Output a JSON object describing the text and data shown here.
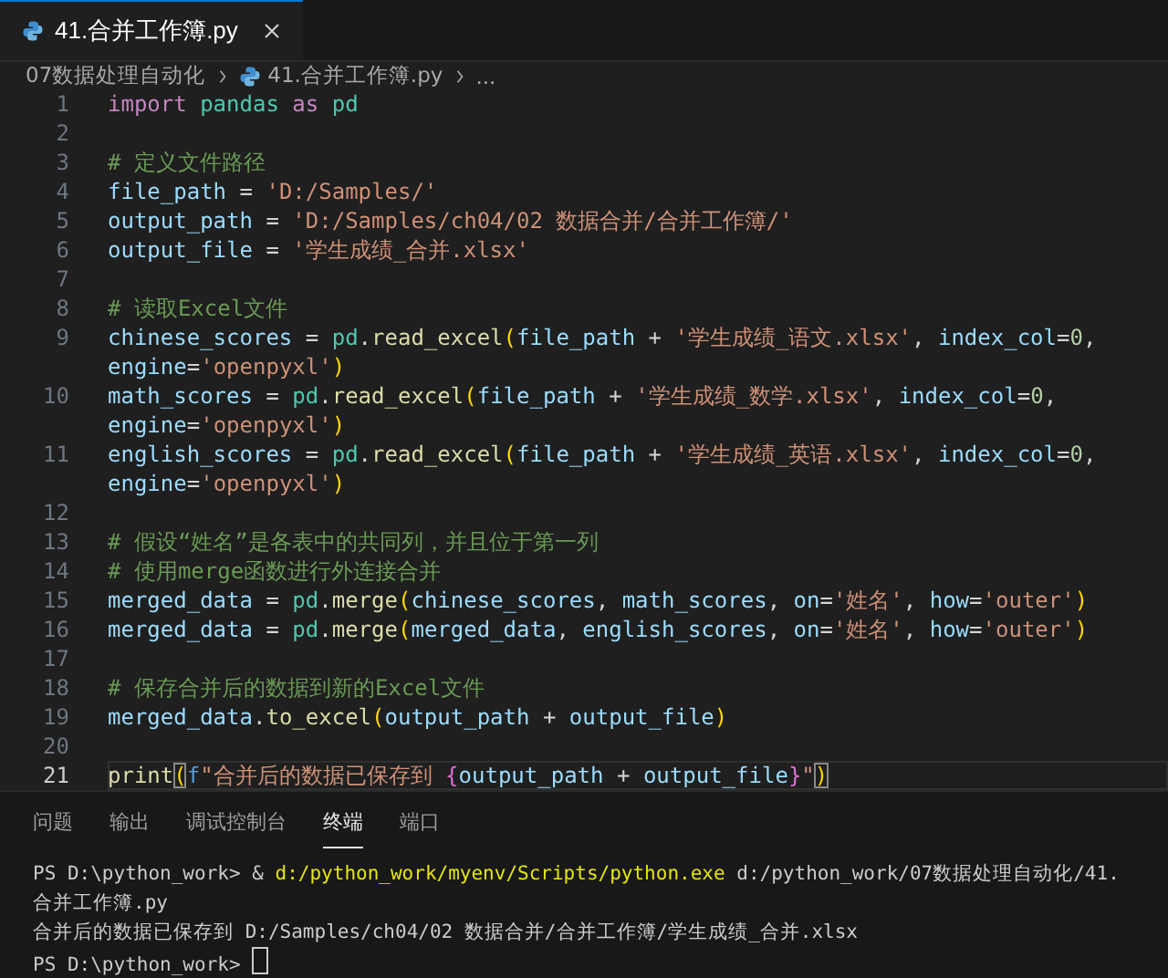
{
  "tabs": [
    {
      "label": "41.合并工作簿.py",
      "selected": true
    }
  ],
  "breadcrumb": {
    "folder": "07数据处理自动化",
    "file": "41.合并工作簿.py",
    "more": "..."
  },
  "editor": {
    "lines": [
      {
        "number": "1",
        "current": false,
        "rows": [
          {
            "tokens": [
              {
                "kind": "kw",
                "text": "import "
              },
              {
                "kind": "mod",
                "text": "pandas "
              },
              {
                "kind": "kw",
                "text": "as "
              },
              {
                "kind": "mod",
                "text": "pd"
              }
            ]
          }
        ]
      },
      {
        "number": "2",
        "current": false
      },
      {
        "number": "3",
        "current": false,
        "rows": [
          {
            "tokens": [
              {
                "kind": "cmt",
                "text": "# 定义文件路径"
              }
            ]
          }
        ]
      },
      {
        "number": "4",
        "current": false,
        "rows": [
          {
            "tokens": [
              {
                "kind": "var",
                "text": "file_path"
              },
              {
                "kind": "op",
                "text": " = "
              },
              {
                "kind": "str",
                "text": "'D:/Samples/'"
              }
            ]
          }
        ]
      },
      {
        "number": "5",
        "current": false,
        "rows": [
          {
            "tokens": [
              {
                "kind": "var",
                "text": "output_path"
              },
              {
                "kind": "op",
                "text": " = "
              },
              {
                "kind": "str",
                "text": "'D:/Samples/ch04/02 数据合并/合并工作簿/'"
              }
            ]
          }
        ]
      },
      {
        "number": "6",
        "current": false,
        "rows": [
          {
            "tokens": [
              {
                "kind": "var",
                "text": "output_file"
              },
              {
                "kind": "op",
                "text": " = "
              },
              {
                "kind": "str",
                "text": "'学生成绩_合并.xlsx'"
              }
            ]
          }
        ]
      },
      {
        "number": "7",
        "current": false
      },
      {
        "number": "8",
        "current": false,
        "rows": [
          {
            "tokens": [
              {
                "kind": "cmt",
                "text": "# 读取Excel文件"
              }
            ]
          }
        ]
      },
      {
        "number": "9",
        "current": false,
        "rows": [
          {
            "tokens": [
              {
                "kind": "var",
                "text": "chinese_scores"
              },
              {
                "kind": "op",
                "text": " = "
              },
              {
                "kind": "mod",
                "text": "pd"
              },
              {
                "kind": "op",
                "text": "."
              },
              {
                "kind": "fn",
                "text": "read_excel"
              },
              {
                "kind": "paren",
                "text": "("
              },
              {
                "kind": "var",
                "text": "file_path"
              },
              {
                "kind": "op",
                "text": " + "
              },
              {
                "kind": "str",
                "text": "'学生成绩_语文.xlsx'"
              },
              {
                "kind": "op",
                "text": ", "
              },
              {
                "kind": "var",
                "text": "index_col"
              },
              {
                "kind": "op",
                "text": "="
              },
              {
                "kind": "num",
                "text": "0"
              },
              {
                "kind": "op",
                "text": ","
              }
            ]
          },
          {
            "tokens": [
              {
                "kind": "var",
                "text": "engine"
              },
              {
                "kind": "op",
                "text": "="
              },
              {
                "kind": "str",
                "text": "'openpyxl'"
              },
              {
                "kind": "paren",
                "text": ")"
              }
            ]
          }
        ]
      },
      {
        "number": "10",
        "current": false,
        "rows": [
          {
            "tokens": [
              {
                "kind": "var",
                "text": "math_scores"
              },
              {
                "kind": "op",
                "text": " = "
              },
              {
                "kind": "mod",
                "text": "pd"
              },
              {
                "kind": "op",
                "text": "."
              },
              {
                "kind": "fn",
                "text": "read_excel"
              },
              {
                "kind": "paren",
                "text": "("
              },
              {
                "kind": "var",
                "text": "file_path"
              },
              {
                "kind": "op",
                "text": " + "
              },
              {
                "kind": "str",
                "text": "'学生成绩_数学.xlsx'"
              },
              {
                "kind": "op",
                "text": ", "
              },
              {
                "kind": "var",
                "text": "index_col"
              },
              {
                "kind": "op",
                "text": "="
              },
              {
                "kind": "num",
                "text": "0"
              },
              {
                "kind": "op",
                "text": ","
              }
            ]
          },
          {
            "tokens": [
              {
                "kind": "var",
                "text": "engine"
              },
              {
                "kind": "op",
                "text": "="
              },
              {
                "kind": "str",
                "text": "'openpyxl'"
              },
              {
                "kind": "paren",
                "text": ")"
              }
            ]
          }
        ]
      },
      {
        "number": "11",
        "current": false,
        "rows": [
          {
            "tokens": [
              {
                "kind": "var",
                "text": "english_scores"
              },
              {
                "kind": "op",
                "text": " = "
              },
              {
                "kind": "mod",
                "text": "pd"
              },
              {
                "kind": "op",
                "text": "."
              },
              {
                "kind": "fn",
                "text": "read_excel"
              },
              {
                "kind": "paren",
                "text": "("
              },
              {
                "kind": "var",
                "text": "file_path"
              },
              {
                "kind": "op",
                "text": " + "
              },
              {
                "kind": "str",
                "text": "'学生成绩_英语.xlsx'"
              },
              {
                "kind": "op",
                "text": ", "
              },
              {
                "kind": "var",
                "text": "index_col"
              },
              {
                "kind": "op",
                "text": "="
              },
              {
                "kind": "num",
                "text": "0"
              },
              {
                "kind": "op",
                "text": ","
              }
            ]
          },
          {
            "tokens": [
              {
                "kind": "var",
                "text": "engine"
              },
              {
                "kind": "op",
                "text": "="
              },
              {
                "kind": "str",
                "text": "'openpyxl'"
              },
              {
                "kind": "paren",
                "text": ")"
              }
            ]
          }
        ]
      },
      {
        "number": "12",
        "current": false
      },
      {
        "number": "13",
        "current": false,
        "rows": [
          {
            "tokens": [
              {
                "kind": "cmt",
                "text": "# 假设“姓名”是各表中的共同列，并且位于第一列"
              }
            ]
          }
        ]
      },
      {
        "number": "14",
        "current": false,
        "rows": [
          {
            "tokens": [
              {
                "kind": "cmt",
                "text": "# 使用merge函数进行外连接合并"
              }
            ]
          }
        ]
      },
      {
        "number": "15",
        "current": false,
        "rows": [
          {
            "tokens": [
              {
                "kind": "var",
                "text": "merged_data"
              },
              {
                "kind": "op",
                "text": " = "
              },
              {
                "kind": "mod",
                "text": "pd"
              },
              {
                "kind": "op",
                "text": "."
              },
              {
                "kind": "fn",
                "text": "merge"
              },
              {
                "kind": "paren",
                "text": "("
              },
              {
                "kind": "var",
                "text": "chinese_scores"
              },
              {
                "kind": "op",
                "text": ", "
              },
              {
                "kind": "var",
                "text": "math_scores"
              },
              {
                "kind": "op",
                "text": ", "
              },
              {
                "kind": "var",
                "text": "on"
              },
              {
                "kind": "op",
                "text": "="
              },
              {
                "kind": "str",
                "text": "'姓名'"
              },
              {
                "kind": "op",
                "text": ", "
              },
              {
                "kind": "var",
                "text": "how"
              },
              {
                "kind": "op",
                "text": "="
              },
              {
                "kind": "str",
                "text": "'outer'"
              },
              {
                "kind": "paren",
                "text": ")"
              }
            ]
          }
        ]
      },
      {
        "number": "16",
        "current": false,
        "rows": [
          {
            "tokens": [
              {
                "kind": "var",
                "text": "merged_data"
              },
              {
                "kind": "op",
                "text": " = "
              },
              {
                "kind": "mod",
                "text": "pd"
              },
              {
                "kind": "op",
                "text": "."
              },
              {
                "kind": "fn",
                "text": "merge"
              },
              {
                "kind": "paren",
                "text": "("
              },
              {
                "kind": "var",
                "text": "merged_data"
              },
              {
                "kind": "op",
                "text": ", "
              },
              {
                "kind": "var",
                "text": "english_scores"
              },
              {
                "kind": "op",
                "text": ", "
              },
              {
                "kind": "var",
                "text": "on"
              },
              {
                "kind": "op",
                "text": "="
              },
              {
                "kind": "str",
                "text": "'姓名'"
              },
              {
                "kind": "op",
                "text": ", "
              },
              {
                "kind": "var",
                "text": "how"
              },
              {
                "kind": "op",
                "text": "="
              },
              {
                "kind": "str",
                "text": "'outer'"
              },
              {
                "kind": "paren",
                "text": ")"
              }
            ]
          }
        ]
      },
      {
        "number": "17",
        "current": false
      },
      {
        "number": "18",
        "current": false,
        "rows": [
          {
            "tokens": [
              {
                "kind": "cmt",
                "text": "# 保存合并后的数据到新的Excel文件"
              }
            ]
          }
        ]
      },
      {
        "number": "19",
        "current": false,
        "rows": [
          {
            "tokens": [
              {
                "kind": "var",
                "text": "merged_data"
              },
              {
                "kind": "op",
                "text": "."
              },
              {
                "kind": "fn",
                "text": "to_excel"
              },
              {
                "kind": "paren",
                "text": "("
              },
              {
                "kind": "var",
                "text": "output_path"
              },
              {
                "kind": "op",
                "text": " + "
              },
              {
                "kind": "var",
                "text": "output_file"
              },
              {
                "kind": "paren",
                "text": ")"
              }
            ]
          }
        ]
      },
      {
        "number": "20",
        "current": false
      },
      {
        "number": "21",
        "current": true,
        "rows": [
          {
            "tokens": [
              {
                "kind": "fn",
                "text": "print"
              },
              {
                "kind": "match",
                "text": "("
              },
              {
                "kind": "fkw",
                "text": "f"
              },
              {
                "kind": "str",
                "text": "\"合并后的数据已保存到 "
              },
              {
                "kind": "brace",
                "text": "{"
              },
              {
                "kind": "var",
                "text": "output_path"
              },
              {
                "kind": "op",
                "text": " + "
              },
              {
                "kind": "var",
                "text": "output_file"
              },
              {
                "kind": "brace",
                "text": "}"
              },
              {
                "kind": "str",
                "text": "\""
              },
              {
                "kind": "match",
                "text": ")"
              }
            ]
          }
        ]
      }
    ]
  },
  "panel": {
    "tabs": [
      {
        "label": "问题",
        "selected": false
      },
      {
        "label": "输出",
        "selected": false
      },
      {
        "label": "调试控制台",
        "selected": false
      },
      {
        "label": "终端",
        "selected": true
      },
      {
        "label": "端口",
        "selected": false
      }
    ],
    "terminal": [
      {
        "cursor": false,
        "segments": [
          {
            "kind": "plain",
            "text": "PS D:\\python_work> & "
          },
          {
            "kind": "exe",
            "text": "d:/python_work/myenv/Scripts/python.exe"
          },
          {
            "kind": "plain",
            "text": " d:/python_work/07数据处理自动化/41."
          }
        ]
      },
      {
        "cursor": false,
        "segments": [
          {
            "kind": "plain",
            "text": "合并工作簿.py"
          }
        ]
      },
      {
        "cursor": false,
        "segments": [
          {
            "kind": "plain",
            "text": "合并后的数据已保存到 D:/Samples/ch04/02 数据合并/合并工作簿/学生成绩_合并.xlsx"
          }
        ]
      },
      {
        "cursor": true,
        "segments": [
          {
            "kind": "plain",
            "text": "PS D:\\python_work> "
          }
        ]
      }
    ]
  }
}
